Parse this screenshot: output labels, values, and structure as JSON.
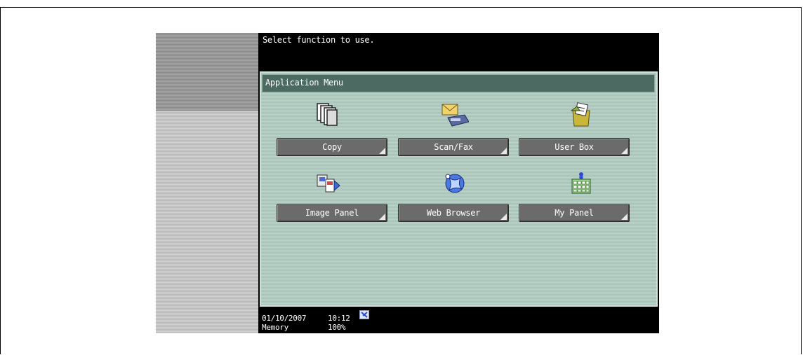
{
  "header": {
    "message": "Select function to use."
  },
  "panel": {
    "title": "Application Menu"
  },
  "apps": [
    {
      "label": "Copy",
      "icon": "copy-icon"
    },
    {
      "label": "Scan/Fax",
      "icon": "scan-fax-icon"
    },
    {
      "label": "User Box",
      "icon": "user-box-icon"
    },
    {
      "label": "Image Panel",
      "icon": "image-panel-icon"
    },
    {
      "label": "Web Browser",
      "icon": "web-browser-icon"
    },
    {
      "label": "My Panel",
      "icon": "my-panel-icon"
    }
  ],
  "status": {
    "date": "01/10/2007",
    "time": "10:12",
    "memory_label": "Memory",
    "memory_value": "100%"
  },
  "colors": {
    "screen_bg": "#000000",
    "panel_bg": "#b3cbc0",
    "header_bg": "#4c6a62",
    "button_bg": "#6b6b6b"
  }
}
